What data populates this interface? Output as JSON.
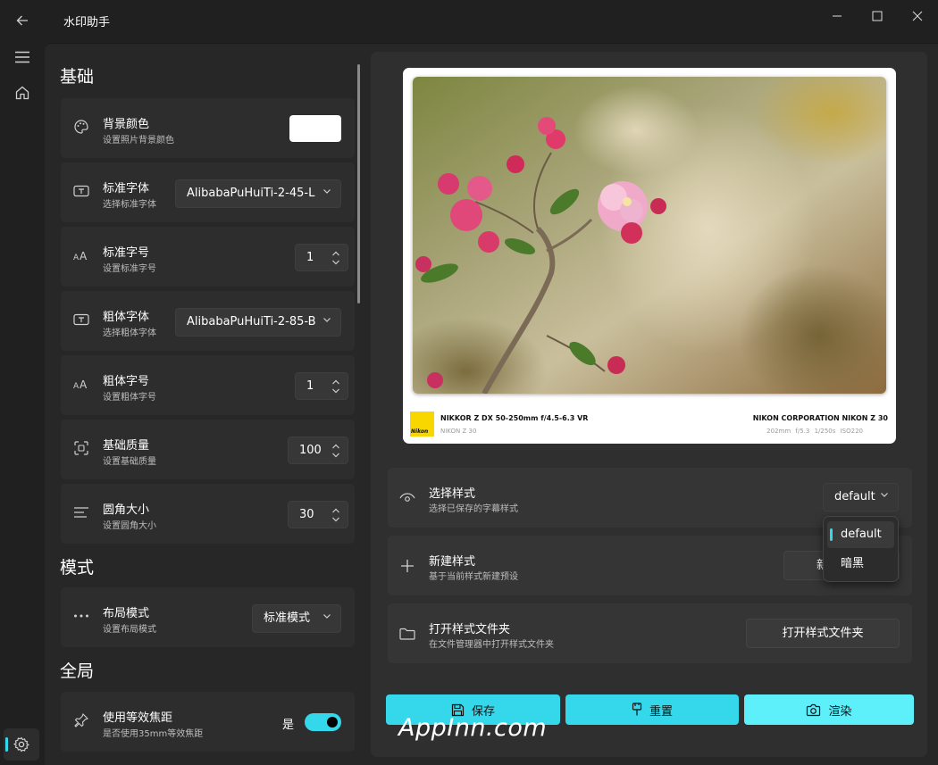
{
  "app": {
    "title": "水印助手"
  },
  "window": {
    "minimize": "—",
    "maximize": "☐",
    "close": "✕"
  },
  "sections": {
    "basic": "基础",
    "mode": "模式",
    "global": "全局"
  },
  "settings": {
    "bg_color": {
      "title": "背景颜色",
      "desc": "设置照片背景颜色",
      "value": "#ffffff"
    },
    "std_font": {
      "title": "标准字体",
      "desc": "选择标准字体",
      "value": "AlibabaPuHuiTi-2-45-L"
    },
    "std_size": {
      "title": "标准字号",
      "desc": "设置标准字号",
      "value": "1"
    },
    "bold_font": {
      "title": "粗体字体",
      "desc": "选择粗体字体",
      "value": "AlibabaPuHuiTi-2-85-B"
    },
    "bold_size": {
      "title": "粗体字号",
      "desc": "设置粗体字号",
      "value": "1"
    },
    "quality": {
      "title": "基础质量",
      "desc": "设置基础质量",
      "value": "100"
    },
    "radius": {
      "title": "圆角大小",
      "desc": "设置圆角大小",
      "value": "30"
    },
    "layout": {
      "title": "布局模式",
      "desc": "设置布局模式",
      "value": "标准模式"
    },
    "focal": {
      "title": "使用等效焦距",
      "desc": "是否使用35mm等效焦距",
      "state_label": "是",
      "on": true
    }
  },
  "preview": {
    "logo_text": "Nikon",
    "left_line1": "NIKKOR Z DX 50-250mm f/4.5-6.3 VR",
    "left_line2": "NIKON Z 30",
    "right_line1": "NIKON CORPORATION NIKON Z 30",
    "right_line2": "202mm  f/5.3  1/250s  ISO220"
  },
  "style": {
    "select": {
      "title": "选择样式",
      "desc": "选择已保存的字幕样式",
      "value": "default"
    },
    "new": {
      "title": "新建样式",
      "desc": "基于当前样式新建预设",
      "button": "新"
    },
    "open": {
      "title": "打开样式文件夹",
      "desc": "在文件管理器中打开样式文件夹",
      "button": "打开样式文件夹"
    },
    "options": [
      "default",
      "暗黑"
    ]
  },
  "actions": {
    "save": "保存",
    "reset": "重置",
    "render": "渲染"
  },
  "watermark": "AppInn.com",
  "colors": {
    "accent": "#34d8ea",
    "accent_light": "#5ef0fa",
    "panel": "#2f2f2f",
    "card": "#2d2d2d"
  }
}
